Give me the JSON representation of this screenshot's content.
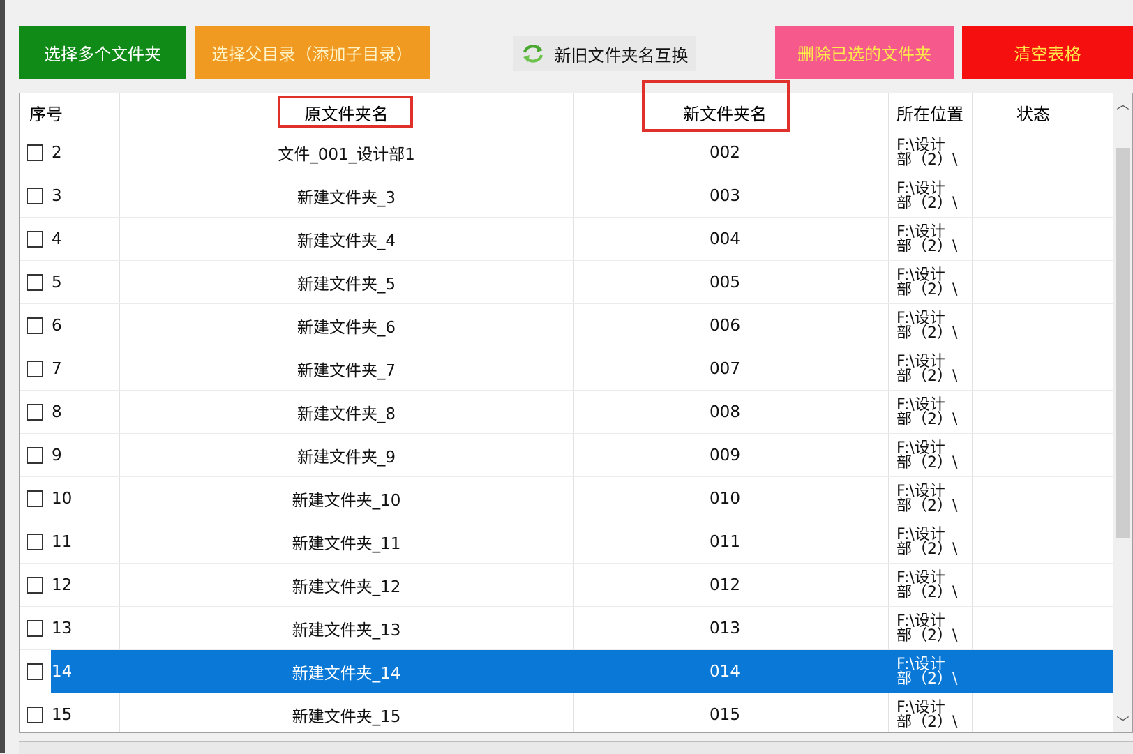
{
  "toolbar": {
    "select_multiple": "选择多个文件夹",
    "select_parent": "选择父目录（添加子目录）",
    "swap_names": "新旧文件夹名互换",
    "delete_selected": "删除已选的文件夹",
    "clear_table": "清空表格",
    "swap_icon": "refresh-arrows-icon"
  },
  "table": {
    "headers": {
      "seq": "序号",
      "original": "原文件夹名",
      "new": "新文件夹名",
      "location": "所在位置",
      "status": "状态"
    },
    "selected_row": 14,
    "rows": [
      {
        "seq": "2",
        "original": "文件_001_设计部1",
        "new": "002",
        "location": "F:\\设计部（2）\\",
        "status": ""
      },
      {
        "seq": "3",
        "original": "新建文件夹_3",
        "new": "003",
        "location": "F:\\设计部（2）\\",
        "status": ""
      },
      {
        "seq": "4",
        "original": "新建文件夹_4",
        "new": "004",
        "location": "F:\\设计部（2）\\",
        "status": ""
      },
      {
        "seq": "5",
        "original": "新建文件夹_5",
        "new": "005",
        "location": "F:\\设计部（2）\\",
        "status": ""
      },
      {
        "seq": "6",
        "original": "新建文件夹_6",
        "new": "006",
        "location": "F:\\设计部（2）\\",
        "status": ""
      },
      {
        "seq": "7",
        "original": "新建文件夹_7",
        "new": "007",
        "location": "F:\\设计部（2）\\",
        "status": ""
      },
      {
        "seq": "8",
        "original": "新建文件夹_8",
        "new": "008",
        "location": "F:\\设计部（2）\\",
        "status": ""
      },
      {
        "seq": "9",
        "original": "新建文件夹_9",
        "new": "009",
        "location": "F:\\设计部（2）\\",
        "status": ""
      },
      {
        "seq": "10",
        "original": "新建文件夹_10",
        "new": "010",
        "location": "F:\\设计部（2）\\",
        "status": ""
      },
      {
        "seq": "11",
        "original": "新建文件夹_11",
        "new": "011",
        "location": "F:\\设计部（2）\\",
        "status": ""
      },
      {
        "seq": "12",
        "original": "新建文件夹_12",
        "new": "012",
        "location": "F:\\设计部（2）\\",
        "status": ""
      },
      {
        "seq": "13",
        "original": "新建文件夹_13",
        "new": "013",
        "location": "F:\\设计部（2）\\",
        "status": ""
      },
      {
        "seq": "14",
        "original": "新建文件夹_14",
        "new": "014",
        "location": "F:\\设计部（2）\\",
        "status": ""
      },
      {
        "seq": "15",
        "original": "新建文件夹_15",
        "new": "015",
        "location": "F:\\设计部（2）\\",
        "status": ""
      }
    ]
  },
  "colors": {
    "select_multiple_bg": "#118b18",
    "select_parent_bg": "#f09a22",
    "delete_bg": "#f65a8c",
    "clear_bg": "#f50f0f",
    "selection": "#0a78d7",
    "annotation_box": "#e0302a"
  }
}
